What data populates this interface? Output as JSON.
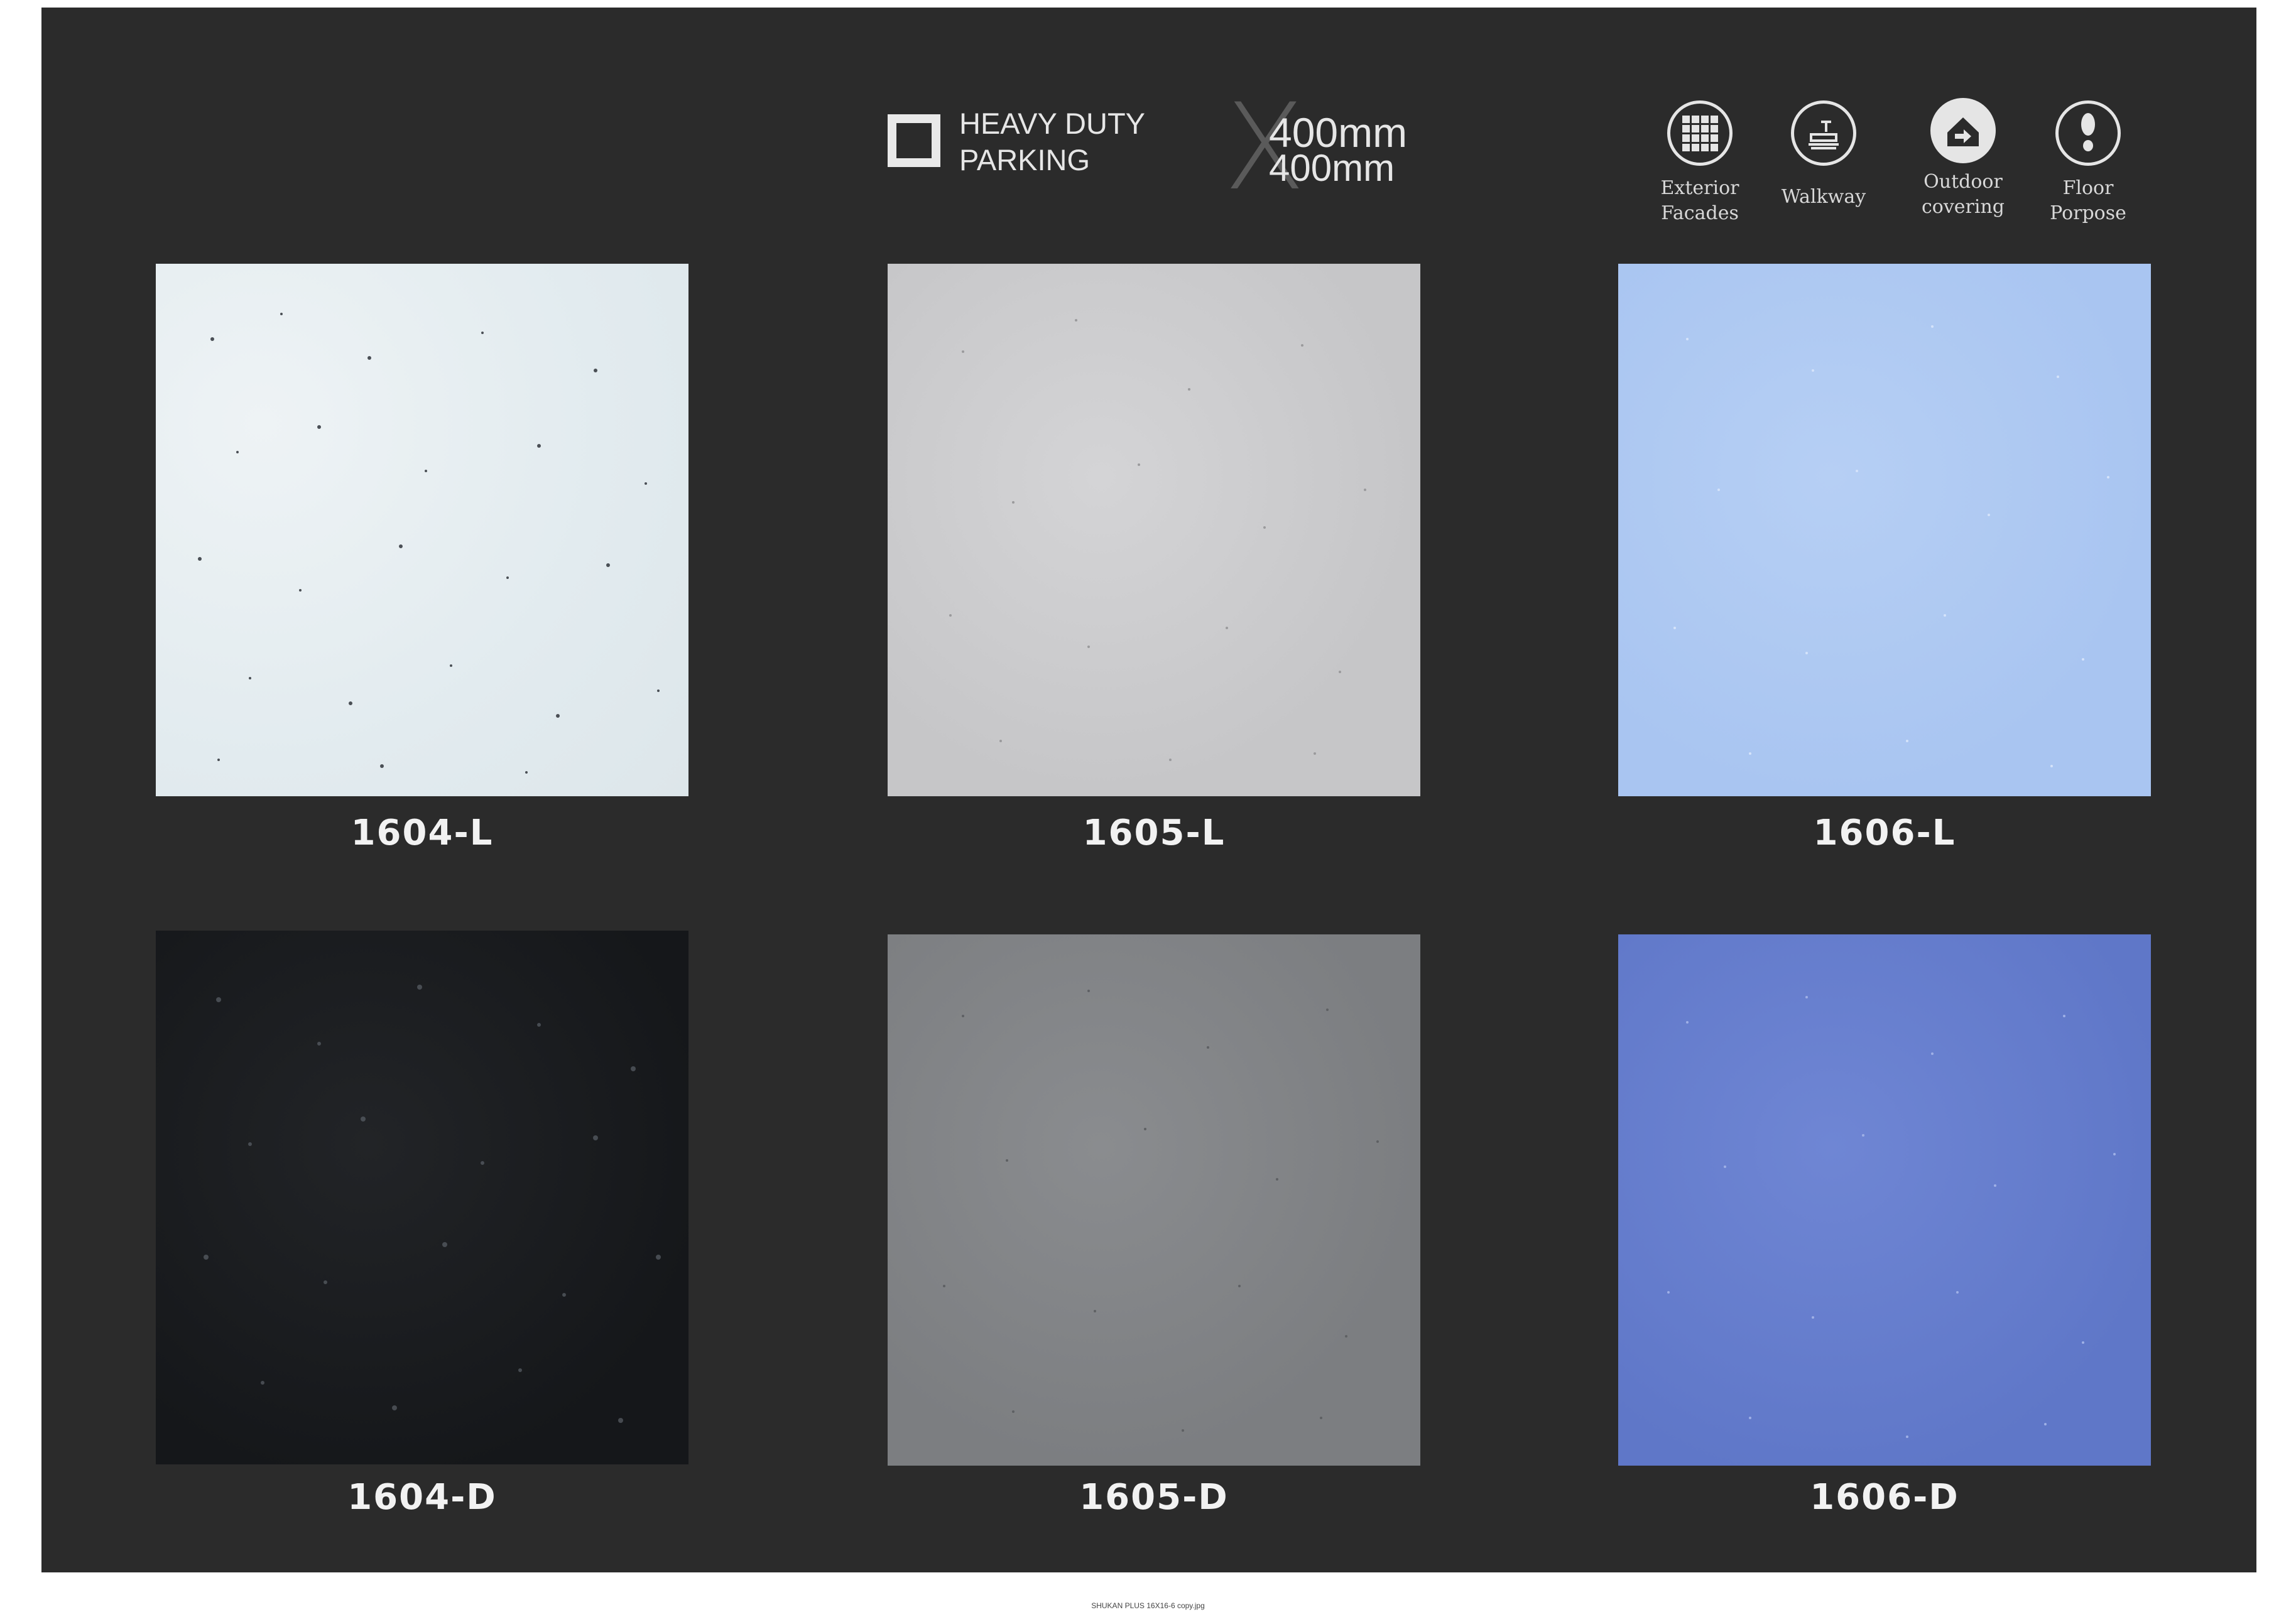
{
  "header": {
    "tag_line1": "HEAVY DUTY",
    "tag_line2": "PARKING",
    "size_top": "400mm",
    "size_bottom": "400mm"
  },
  "usage": [
    {
      "label": "Exterior\nFacades",
      "icon": "grid-icon"
    },
    {
      "label": "Walkway",
      "icon": "walkway-icon"
    },
    {
      "label": "Outdoor\ncovering",
      "icon": "outdoor-covering-icon"
    },
    {
      "label": "Floor\nPorpose",
      "icon": "footprint-icon"
    }
  ],
  "tiles": [
    {
      "code": "1604-L",
      "color": "#e4ecf0"
    },
    {
      "code": "1605-L",
      "color": "#cbcbcd"
    },
    {
      "code": "1606-L",
      "color": "#afc9f2"
    },
    {
      "code": "1604-D",
      "color": "#1a1c1f"
    },
    {
      "code": "1605-D",
      "color": "#818386"
    },
    {
      "code": "1606-D",
      "color": "#647bcc"
    }
  ],
  "footer": "SHUKAN PLUS 16X16-6 copy.jpg",
  "colors": {
    "background": "#2b2b2b",
    "page": "#ffffff",
    "text": "#e6e6e6"
  }
}
